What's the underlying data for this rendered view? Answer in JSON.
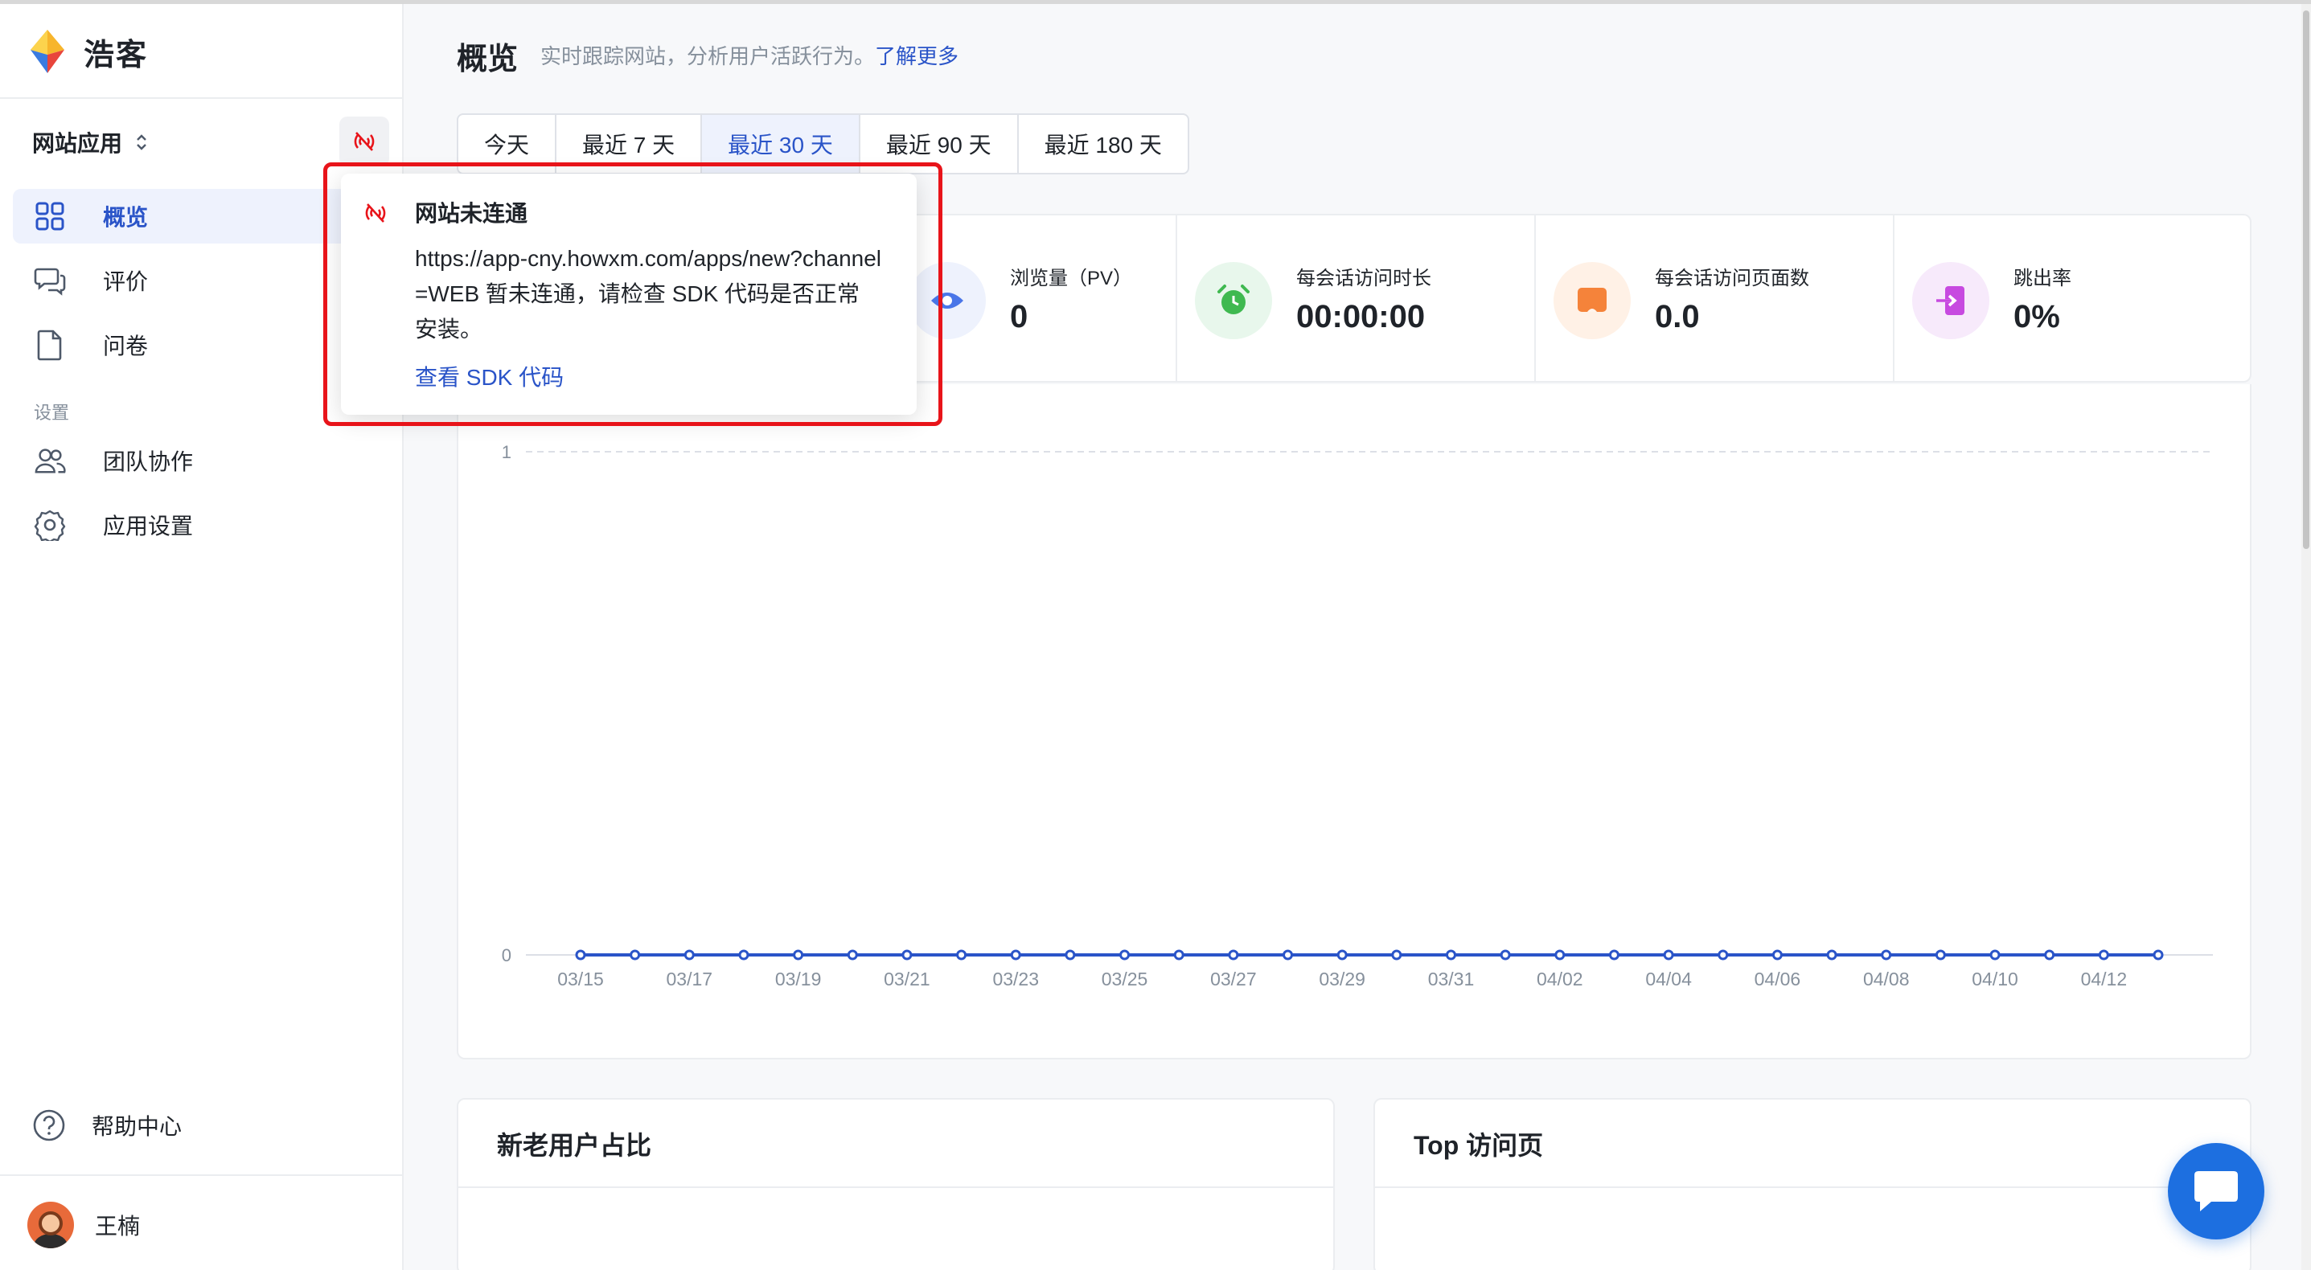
{
  "brand": {
    "name": "浩客"
  },
  "sidebar": {
    "app_switch_label": "网站应用",
    "items": [
      {
        "label": "概览",
        "icon": "grid-icon",
        "active": true
      },
      {
        "label": "评价",
        "icon": "chat-bubbles-icon"
      },
      {
        "label": "问卷",
        "icon": "document-icon"
      }
    ],
    "section_label": "设置",
    "settings_items": [
      {
        "label": "团队协作",
        "icon": "team-icon"
      },
      {
        "label": "应用设置",
        "icon": "gear-icon"
      }
    ],
    "help_label": "帮助中心",
    "user_name": "王楠"
  },
  "header": {
    "title": "概览",
    "description": "实时跟踪网站，分析用户活跃行为。",
    "learn_more": "了解更多"
  },
  "ranges": {
    "items": [
      "今天",
      "最近 7 天",
      "最近 30 天",
      "最近 90 天",
      "最近 180 天"
    ],
    "active_index": 2
  },
  "stats": [
    {
      "label": "浏览量（PV）",
      "value": "0",
      "icon": "eye-icon",
      "color": "#4a76e8"
    },
    {
      "label": "每会话访问时长",
      "value": "00:00:00",
      "icon": "alarm-clock-icon",
      "color": "#3fb950"
    },
    {
      "label": "每会话访问页面数",
      "value": "0.0",
      "icon": "page-icon",
      "color": "#f5833a"
    },
    {
      "label": "跳出率",
      "value": "0%",
      "icon": "exit-icon",
      "color": "#c74ae0"
    }
  ],
  "chart_data": {
    "type": "line",
    "y_ticks": [
      "1",
      "0"
    ],
    "ylim": [
      0,
      1
    ],
    "grid": true,
    "x_tick_labels": [
      "03/15",
      "03/17",
      "03/19",
      "03/21",
      "03/23",
      "03/25",
      "03/27",
      "03/29",
      "03/31",
      "04/02",
      "04/04",
      "04/06",
      "04/08",
      "04/10",
      "04/12"
    ],
    "x": [
      "03/15",
      "03/16",
      "03/17",
      "03/18",
      "03/19",
      "03/20",
      "03/21",
      "03/22",
      "03/23",
      "03/24",
      "03/25",
      "03/26",
      "03/27",
      "03/28",
      "03/29",
      "03/30",
      "03/31",
      "04/01",
      "04/02",
      "04/03",
      "04/04",
      "04/05",
      "04/06",
      "04/07",
      "04/08",
      "04/09",
      "04/10",
      "04/11",
      "04/12",
      "04/13"
    ],
    "values": [
      0,
      0,
      0,
      0,
      0,
      0,
      0,
      0,
      0,
      0,
      0,
      0,
      0,
      0,
      0,
      0,
      0,
      0,
      0,
      0,
      0,
      0,
      0,
      0,
      0,
      0,
      0,
      0,
      0,
      0
    ],
    "color": "#2a54c8"
  },
  "cards": [
    {
      "title": "新老用户占比"
    },
    {
      "title": "Top 访问页"
    }
  ],
  "popover": {
    "title": "网站未连通",
    "message": "https://app-cny.howxm.com/apps/new?channel=WEB 暂未连通，请检查 SDK 代码是否正常安装。",
    "link": "查看 SDK 代码",
    "alert_color": "#e8141a"
  }
}
